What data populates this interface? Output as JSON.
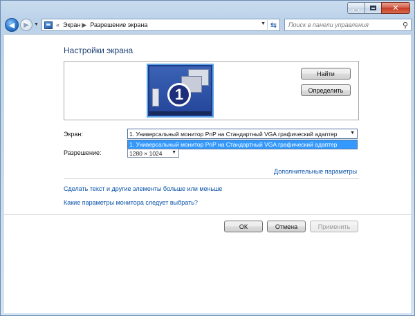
{
  "window": {
    "minimize_icon": "minimize-icon",
    "maximize_icon": "maximize-icon",
    "close_icon": "close-icon"
  },
  "navigation": {
    "breadcrumbs": [
      "Экран",
      "Разрешение экрана"
    ],
    "overflow_glyph": "«",
    "search_placeholder": "Поиск в панели управления"
  },
  "page": {
    "title": "Настройки экрана",
    "monitor_number": "1",
    "find_button": "Найти",
    "identify_button": "Определить",
    "screen_label": "Экран:",
    "screen_selected": "1. Универсальный монитор PnP на Стандартный VGA графический адаптер",
    "screen_options": [
      "1. Универсальный монитор PnP на Стандартный VGA графический адаптер"
    ],
    "resolution_label": "Разрешение:",
    "resolution_value": "1280 × 1024",
    "advanced_link": "Дополнительные параметры",
    "text_size_link": "Сделать текст и другие элементы больше или меньше",
    "monitor_settings_link": "Какие параметры монитора следует выбрать?"
  },
  "buttons": {
    "ok": "ОК",
    "cancel": "Отмена",
    "apply": "Применить"
  },
  "colors": {
    "accent": "#3399ff",
    "link": "#0a52a8",
    "title": "#1e3f73",
    "close": "#c43b23"
  }
}
